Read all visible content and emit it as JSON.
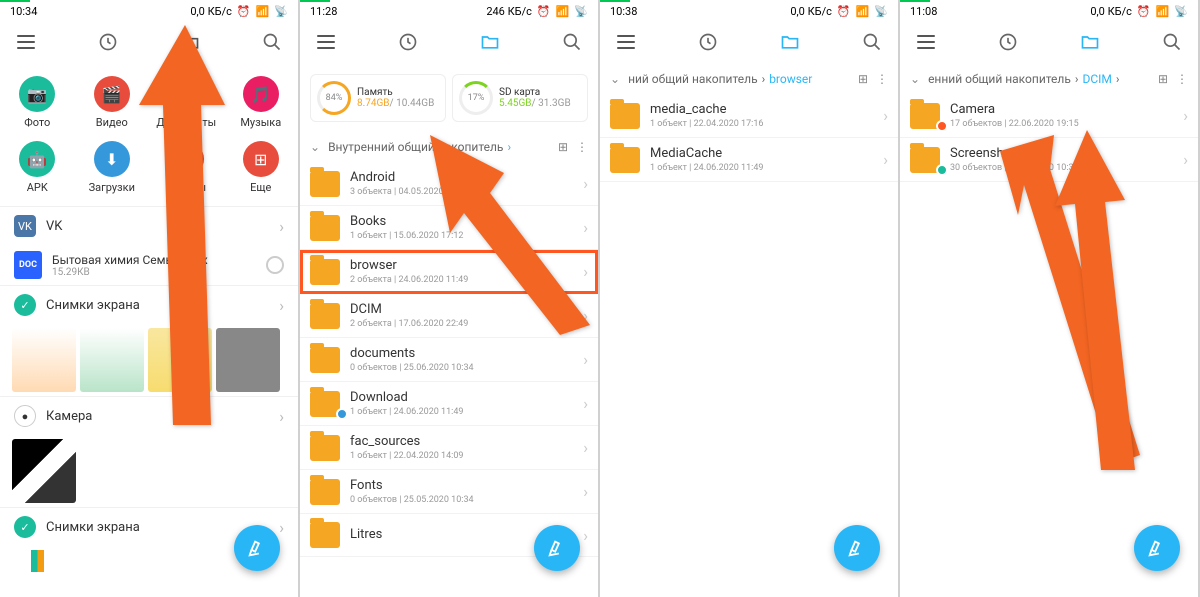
{
  "p1": {
    "time": "10:34",
    "net": "0,0 КБ/с",
    "cats": [
      {
        "label": "Фото",
        "color": "bg-gr"
      },
      {
        "label": "Видео",
        "color": "bg-rd"
      },
      {
        "label": "Документы",
        "color": "bg-bl"
      },
      {
        "label": "Музыка",
        "color": "bg-pk"
      },
      {
        "label": "APK",
        "color": "bg-gr"
      },
      {
        "label": "Загрузки",
        "color": "bg-bl"
      },
      {
        "label": "Архивы",
        "color": "bg-rd"
      },
      {
        "label": "Еще",
        "color": "bg-rd"
      }
    ],
    "sec_vk": "VK",
    "file": {
      "name": "Бытовая химия Семья.docx",
      "meta": "15.29КВ",
      "icon": "DOC"
    },
    "sec_shots": "Снимки экрана",
    "sec_cam": "Камера",
    "sec_shots2": "Снимки экрана"
  },
  "p2": {
    "time": "11:28",
    "net": "246 КБ/с",
    "stor1": {
      "pct": "84%",
      "title": "Память",
      "used": "8.74GB",
      "total": "/ 10.44GB"
    },
    "stor2": {
      "pct": "17%",
      "title": "SD карта",
      "used": "5.45GB",
      "total": "/ 31.3GB"
    },
    "path": "Внутренний общий накопитель",
    "folders": [
      {
        "name": "Android",
        "meta": "3 объекта  |  04.05.2020 10:07"
      },
      {
        "name": "Books",
        "meta": "1 объект  |  15.06.2020 17:12"
      },
      {
        "name": "browser",
        "meta": "2 объекта  |  24.06.2020 11:49",
        "hl": true
      },
      {
        "name": "DCIM",
        "meta": "2 объекта  |  17.06.2020 22:49"
      },
      {
        "name": "documents",
        "meta": "0 объектов  |  25.06.2020 10:34"
      },
      {
        "name": "Download",
        "meta": "1 объект  |  24.06.2020 11:49",
        "badge": "#3498db"
      },
      {
        "name": "fac_sources",
        "meta": "1 объект  |  22.04.2020 14:09"
      },
      {
        "name": "Fonts",
        "meta": "0 объектов  |  25.05.2020 10:34"
      },
      {
        "name": "Litres",
        "meta": ""
      }
    ]
  },
  "p3": {
    "time": "10:38",
    "net": "0,0 КБ/с",
    "crumb_a": "ний общий накопитель",
    "crumb_b": "browser",
    "folders": [
      {
        "name": "media_cache",
        "meta": "1 объект  |  22.04.2020 17:16"
      },
      {
        "name": "MediaCache",
        "meta": "1 объект  |  24.06.2020 11:49"
      }
    ]
  },
  "p4": {
    "time": "11:08",
    "net": "0,0 КБ/с",
    "crumb_a": "енний общий накопитель",
    "crumb_b": "DCIM",
    "folders": [
      {
        "name": "Camera",
        "meta": "17 объектов  |  22.06.2020 19:15",
        "badge": "#ff5722"
      },
      {
        "name": "Screenshots",
        "meta": "30 объектов  |  25.06.2020 10:38",
        "badge": "#1abc9c"
      }
    ]
  }
}
